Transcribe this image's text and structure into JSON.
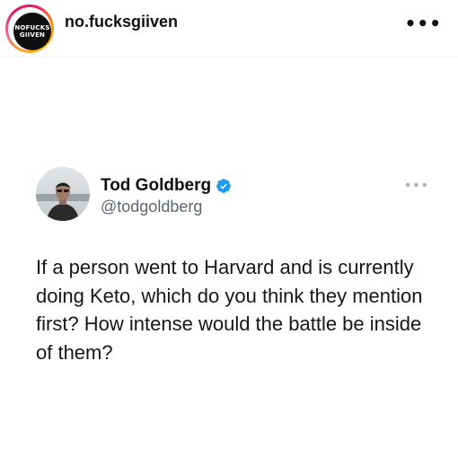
{
  "post": {
    "username": "no.fucksgiiven",
    "avatar_logo": {
      "line1": "NOFUCKS",
      "line2": "GIIVEN"
    },
    "more_icon": "more-horizontal-icon",
    "more_glyph": "•••"
  },
  "tweet": {
    "display_name": "Tod Goldberg",
    "handle": "@todgoldberg",
    "verified": true,
    "verified_color": "#1d9bf0",
    "more_glyph": "•••",
    "text": "If a person went to Harvard and is currently doing Keto, which do you think they mention first? How intense would the battle be inside of them?"
  }
}
